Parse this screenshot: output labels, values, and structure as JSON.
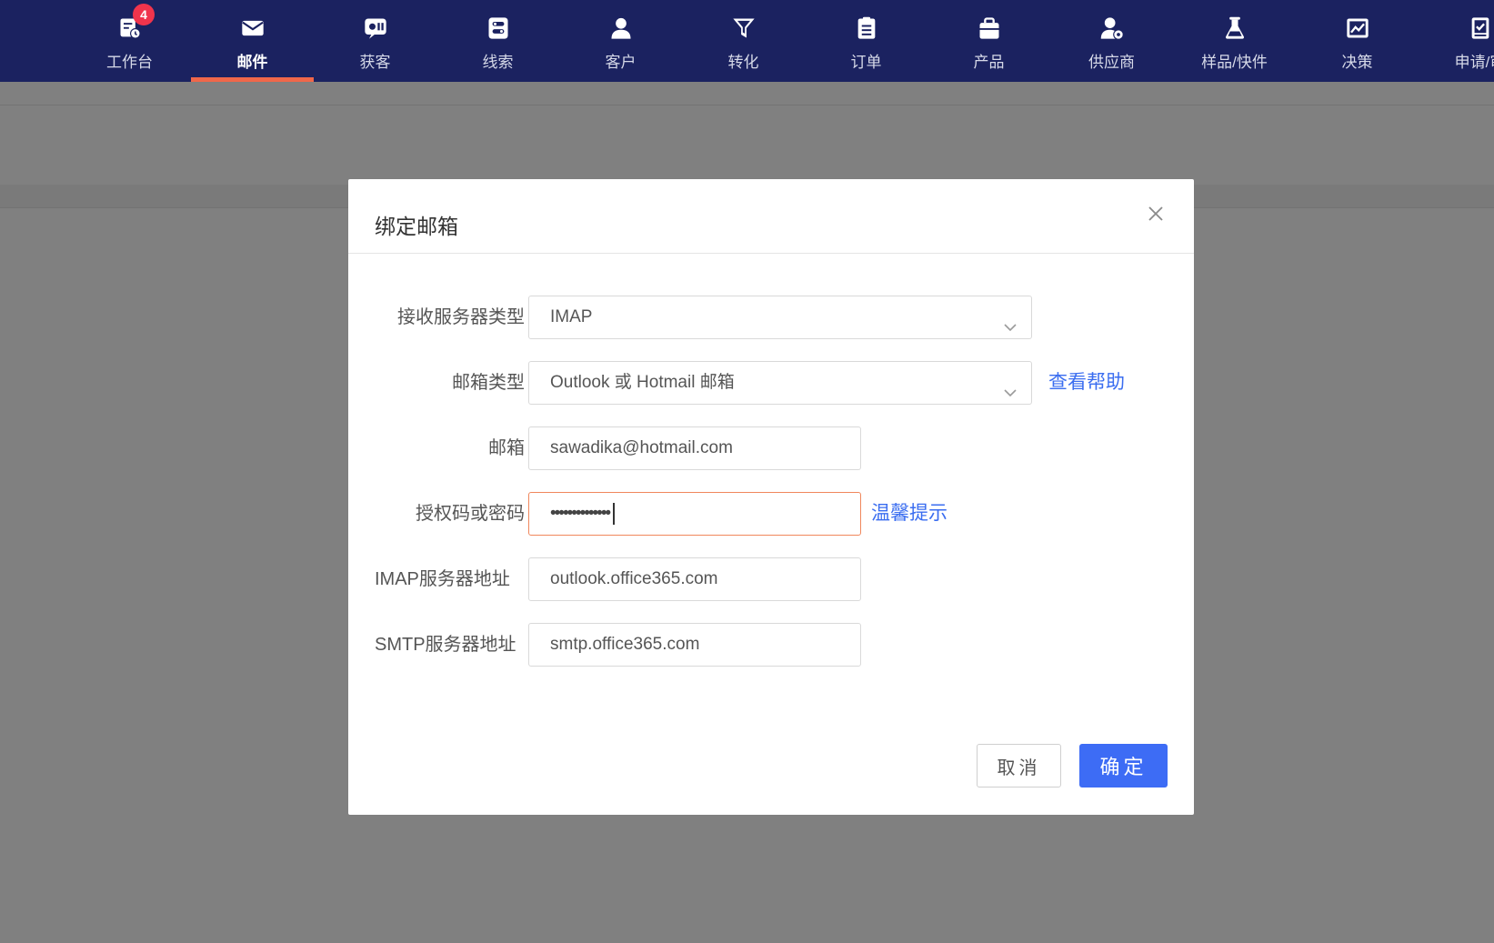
{
  "nav": {
    "items": [
      {
        "label": "工作台",
        "icon": "workbench-icon",
        "badge": "4"
      },
      {
        "label": "邮件",
        "icon": "mail-icon",
        "active": true
      },
      {
        "label": "获客",
        "icon": "acquire-icon"
      },
      {
        "label": "线索",
        "icon": "leads-icon"
      },
      {
        "label": "客户",
        "icon": "customer-icon"
      },
      {
        "label": "转化",
        "icon": "funnel-icon"
      },
      {
        "label": "订单",
        "icon": "order-icon"
      },
      {
        "label": "产品",
        "icon": "product-icon"
      },
      {
        "label": "供应商",
        "icon": "supplier-icon"
      },
      {
        "label": "样品/快件",
        "icon": "sample-icon"
      },
      {
        "label": "决策",
        "icon": "chart-icon"
      },
      {
        "label": "申请/审",
        "icon": "approval-icon"
      }
    ],
    "active_color": "#f0674a",
    "bg_color": "#1b2260"
  },
  "modal": {
    "title": "绑定邮箱",
    "fields": {
      "server_type": {
        "label": "接收服务器类型",
        "value": "IMAP"
      },
      "mailbox_type": {
        "label": "邮箱类型",
        "value": "Outlook 或 Hotmail 邮箱",
        "help": "查看帮助"
      },
      "email": {
        "label": "邮箱",
        "value": "sawadika@hotmail.com"
      },
      "password": {
        "label": "授权码或密码",
        "value": "••••••••••••••",
        "help": "温馨提示"
      },
      "imap": {
        "label": "IMAP服务器地址",
        "value": "outlook.office365.com"
      },
      "smtp": {
        "label": "SMTP服务器地址",
        "value": "smtp.office365.com"
      }
    },
    "cancel_label": "取消",
    "ok_label": "确定"
  },
  "colors": {
    "primary": "#3d6cf5",
    "link": "#3a6df0",
    "focus_border": "#f0875c",
    "badge": "#f0344c"
  }
}
